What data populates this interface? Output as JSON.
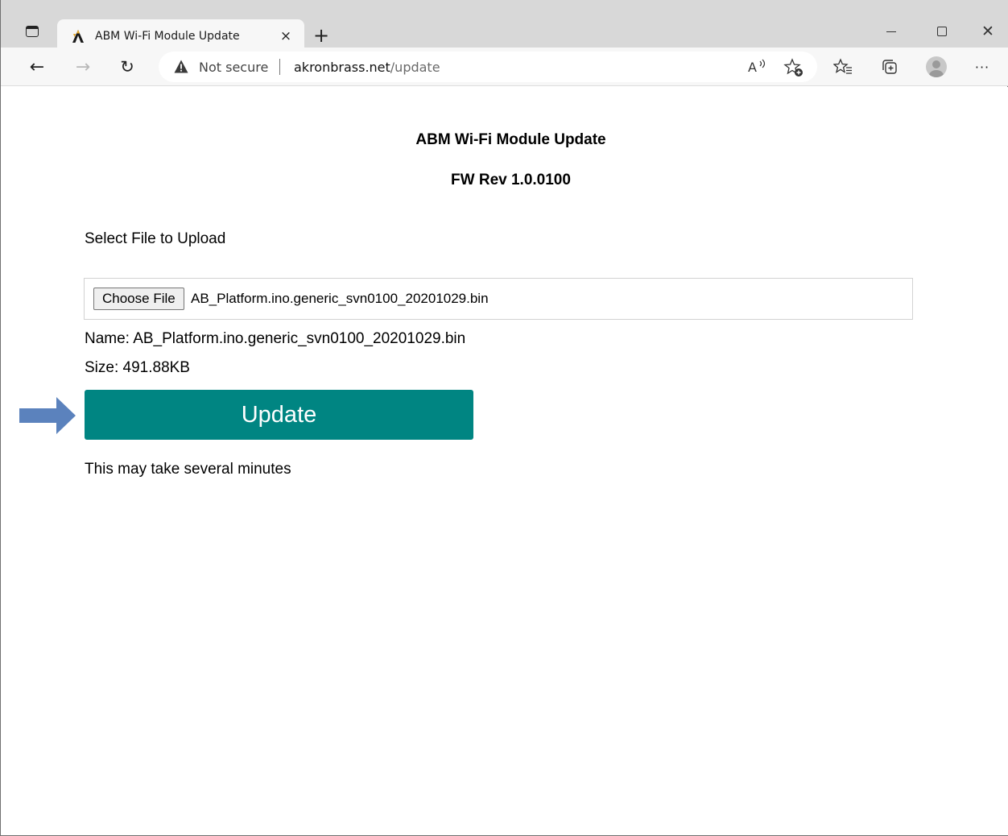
{
  "browser": {
    "tab": {
      "title": "ABM Wi-Fi Module Update",
      "close_glyph": "×",
      "favicon": "akron-brass-logo-icon"
    },
    "new_tab_glyph": "+",
    "window_controls": {
      "minimize": "minimize-icon",
      "maximize": "maximize-icon",
      "close_glyph": "✕"
    },
    "nav": {
      "back_glyph": "←",
      "forward_glyph": "→",
      "reload_glyph": "↻"
    },
    "address_bar": {
      "security_label": "Not secure",
      "url_host": "akronbrass.net",
      "url_path": "/update",
      "read_aloud_glyph": "A",
      "read_aloud_suffix": "ⅽ"
    },
    "toolbar": {
      "more_glyph": "···"
    }
  },
  "page": {
    "title": "ABM Wi-Fi Module Update",
    "fw_rev": "FW Rev 1.0.0100",
    "select_label": "Select File to Upload",
    "file_input": {
      "button_label": "Choose File",
      "selected_file": "AB_Platform.ino.generic_svn0100_20201029.bin"
    },
    "file_name_line": "Name: AB_Platform.ino.generic_svn0100_20201029.bin",
    "file_size_line": "Size: 491.88KB",
    "update_button": "Update",
    "note": "This may take several minutes"
  },
  "colors": {
    "update_button_bg": "#008582",
    "annotation_arrow": "#5b82bd"
  }
}
